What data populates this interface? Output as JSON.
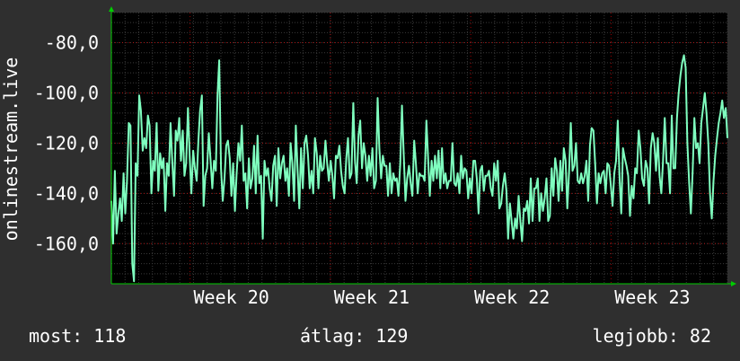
{
  "chart_data": {
    "type": "line",
    "ylabel": "onlinestream.live",
    "xlabel": "",
    "title": "",
    "ylim": [
      -176,
      -68
    ],
    "xlim": [
      0,
      360
    ],
    "yticks": [
      -80,
      -100,
      -120,
      -140,
      -160
    ],
    "ytick_labels": [
      "-80,0",
      "-100,0",
      "-120,0",
      "-140,0",
      "-160,0"
    ],
    "xticks": [
      {
        "x": 46,
        "label": "Week 20"
      },
      {
        "x": 128,
        "label": "Week 21"
      },
      {
        "x": 210,
        "label": "Week 22"
      },
      {
        "x": 292,
        "label": "Week 23"
      }
    ],
    "grid": true,
    "colors": {
      "background": "#2f2f2f",
      "plot_background": "#000000",
      "grid_minor": "#3a3a3a",
      "grid_major": "#ff0000",
      "line": "#7fffbf",
      "axis_arrow": "#00cc00",
      "text": "#ffffff"
    },
    "series": [
      {
        "values": [
          -143,
          -160,
          -131,
          -156,
          -148,
          -142,
          -151,
          -132,
          -148,
          -135,
          -112,
          -113,
          -168,
          -175,
          -128,
          -133,
          -101,
          -107,
          -123,
          -118,
          -122,
          -109,
          -113,
          -140,
          -127,
          -131,
          -112,
          -139,
          -124,
          -130,
          -126,
          -147,
          -128,
          -133,
          -112,
          -127,
          -141,
          -115,
          -119,
          -110,
          -127,
          -115,
          -133,
          -128,
          -106,
          -125,
          -140,
          -123,
          -130,
          -135,
          -119,
          -107,
          -101,
          -145,
          -133,
          -130,
          -116,
          -127,
          -138,
          -127,
          -131,
          -101,
          -87,
          -130,
          -143,
          -134,
          -121,
          -119,
          -126,
          -141,
          -128,
          -147,
          -132,
          -120,
          -127,
          -113,
          -135,
          -132,
          -146,
          -126,
          -138,
          -134,
          -121,
          -140,
          -117,
          -136,
          -133,
          -158,
          -127,
          -133,
          -130,
          -138,
          -143,
          -129,
          -125,
          -145,
          -122,
          -134,
          -128,
          -125,
          -135,
          -130,
          -141,
          -120,
          -128,
          -143,
          -113,
          -131,
          -146,
          -122,
          -138,
          -120,
          -117,
          -125,
          -138,
          -131,
          -140,
          -118,
          -124,
          -138,
          -125,
          -131,
          -130,
          -119,
          -128,
          -135,
          -127,
          -133,
          -142,
          -125,
          -126,
          -121,
          -131,
          -137,
          -140,
          -126,
          -118,
          -134,
          -132,
          -104,
          -127,
          -136,
          -117,
          -111,
          -130,
          -120,
          -125,
          -135,
          -125,
          -133,
          -122,
          -138,
          -135,
          -102,
          -122,
          -134,
          -125,
          -129,
          -129,
          -141,
          -128,
          -140,
          -132,
          -135,
          -134,
          -141,
          -128,
          -105,
          -125,
          -143,
          -134,
          -129,
          -136,
          -141,
          -119,
          -128,
          -140,
          -132,
          -133,
          -133,
          -135,
          -111,
          -126,
          -141,
          -127,
          -135,
          -125,
          -134,
          -123,
          -138,
          -122,
          -136,
          -132,
          -138,
          -135,
          -135,
          -120,
          -136,
          -137,
          -132,
          -140,
          -125,
          -134,
          -130,
          -131,
          -142,
          -134,
          -140,
          -127,
          -127,
          -134,
          -148,
          -131,
          -129,
          -139,
          -133,
          -133,
          -131,
          -138,
          -141,
          -128,
          -135,
          -127,
          -146,
          -144,
          -137,
          -132,
          -139,
          -158,
          -144,
          -151,
          -158,
          -150,
          -154,
          -141,
          -151,
          -159,
          -146,
          -147,
          -143,
          -152,
          -134,
          -151,
          -138,
          -138,
          -134,
          -151,
          -140,
          -147,
          -142,
          -134,
          -151,
          -149,
          -130,
          -141,
          -126,
          -131,
          -143,
          -127,
          -139,
          -122,
          -127,
          -146,
          -131,
          -112,
          -131,
          -129,
          -120,
          -135,
          -136,
          -132,
          -136,
          -133,
          -127,
          -143,
          -121,
          -114,
          -115,
          -128,
          -144,
          -132,
          -136,
          -132,
          -131,
          -140,
          -128,
          -129,
          -137,
          -145,
          -132,
          -127,
          -111,
          -134,
          -148,
          -122,
          -126,
          -129,
          -133,
          -149,
          -137,
          -142,
          -130,
          -132,
          -115,
          -122,
          -134,
          -137,
          -127,
          -130,
          -144,
          -122,
          -116,
          -120,
          -131,
          -118,
          -133,
          -140,
          -127,
          -110,
          -128,
          -128,
          -140,
          -109,
          -130,
          -130,
          -110,
          -100,
          -93,
          -88,
          -85,
          -90,
          -120,
          -136,
          -148,
          -132,
          -110,
          -122,
          -120,
          -128,
          -112,
          -106,
          -100,
          -108,
          -120,
          -140,
          -150,
          -135,
          -125,
          -118,
          -112,
          -108,
          -103,
          -110,
          -106,
          -118
        ]
      }
    ]
  },
  "stats": {
    "current": "most: 118",
    "average": "átlag: 129",
    "best": "legjobb: 82"
  }
}
